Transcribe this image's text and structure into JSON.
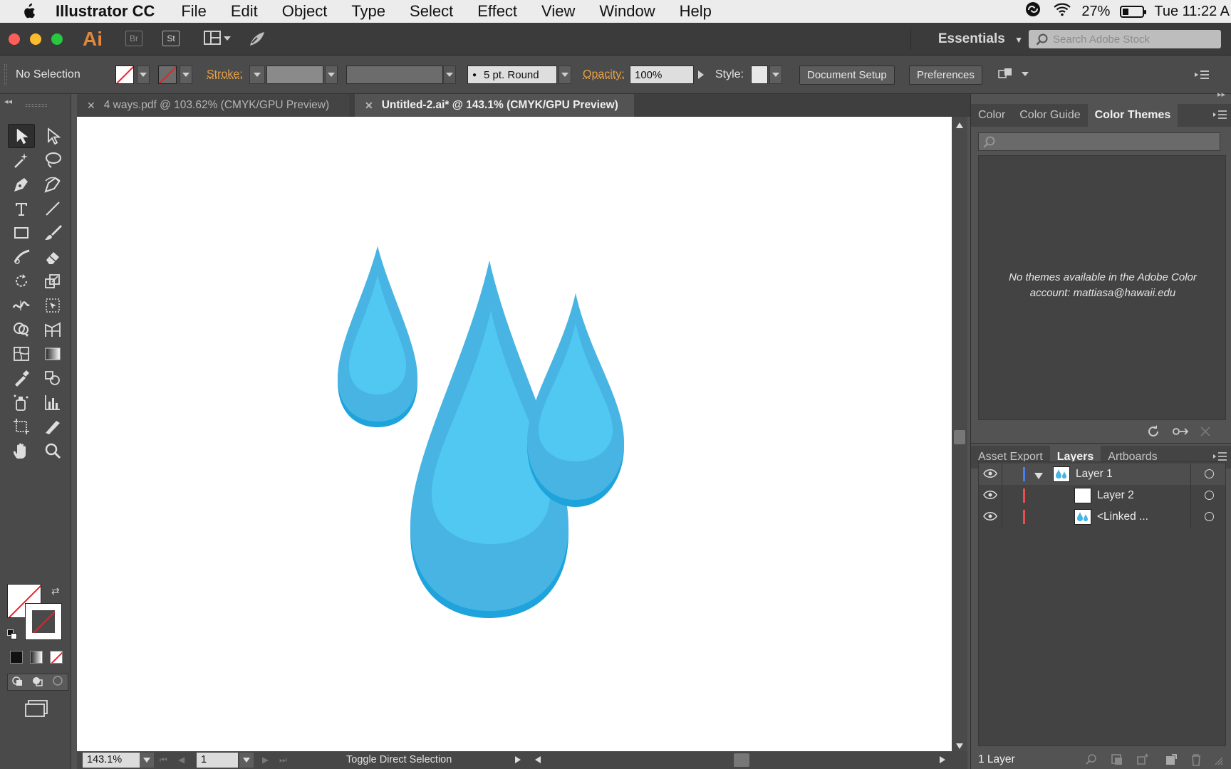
{
  "menubar": {
    "app_name": "Illustrator CC",
    "items": [
      "File",
      "Edit",
      "Object",
      "Type",
      "Select",
      "Effect",
      "View",
      "Window",
      "Help"
    ],
    "battery": "27%",
    "clock": "Tue 11:22 A"
  },
  "appbar": {
    "logo": "Ai",
    "bridge": "Br",
    "stock": "St",
    "workspace": "Essentials",
    "search_placeholder": "Search Adobe Stock"
  },
  "control": {
    "selection": "No Selection",
    "stroke_label": "Stroke:",
    "brush": "5 pt. Round",
    "opacity_label": "Opacity:",
    "opacity_value": "100%",
    "style_label": "Style:",
    "document_setup": "Document Setup",
    "preferences": "Preferences"
  },
  "tabs": [
    {
      "label": "4 ways.pdf @ 103.62% (CMYK/GPU Preview)",
      "active": false
    },
    {
      "label": "Untitled-2.ai* @ 143.1% (CMYK/GPU Preview)",
      "active": true
    }
  ],
  "status": {
    "zoom": "143.1%",
    "page": "1",
    "message": "Toggle Direct Selection"
  },
  "color_panel": {
    "tabs": [
      "Color",
      "Color Guide",
      "Color Themes"
    ],
    "active_tab": "Color Themes",
    "message_line1": "No themes available in the Adobe Color",
    "message_line2": "account: mattiasa@hawaii.edu"
  },
  "layers_panel": {
    "tabs": [
      "Asset Export",
      "Layers",
      "Artboards"
    ],
    "active_tab": "Layers",
    "rows": [
      {
        "name": "Layer 1",
        "color": "#4a7ef2"
      },
      {
        "name": "Layer 2",
        "color": "#e94f4f"
      },
      {
        "name": "<Linked ...",
        "color": "#e94f4f"
      }
    ],
    "footer": "1 Layer"
  },
  "colors": {
    "drop_dark": "#1ea3dc",
    "drop_mid": "#48b4e3",
    "drop_light": "#50c8f2"
  }
}
